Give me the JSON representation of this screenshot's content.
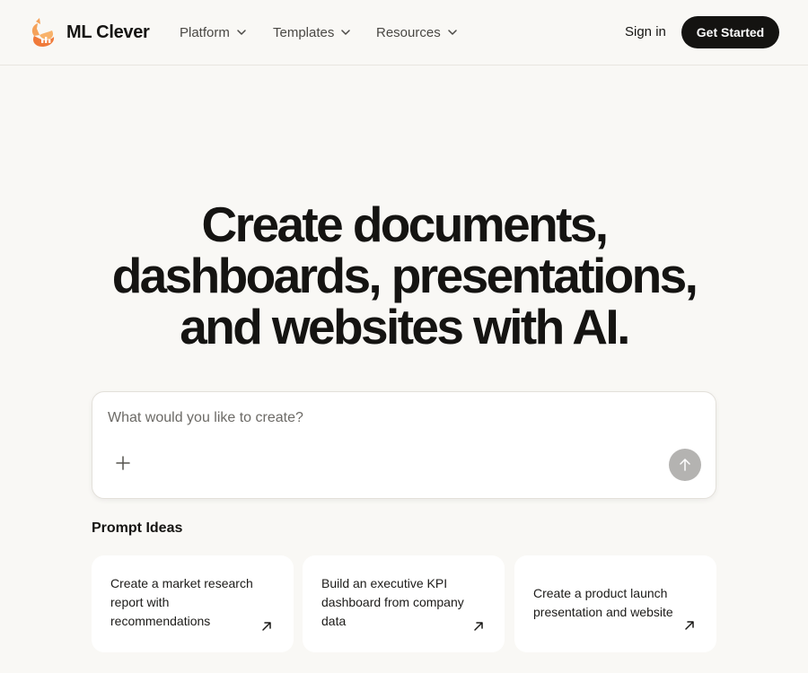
{
  "header": {
    "brand_name": "ML Clever",
    "logo_icon": "fox-logo-icon",
    "nav": [
      {
        "label": "Platform"
      },
      {
        "label": "Templates"
      },
      {
        "label": "Resources"
      }
    ],
    "signin_label": "Sign in",
    "cta_label": "Get Started"
  },
  "hero": {
    "title_lines": [
      "Create documents,",
      "dashboards, presentations,",
      "and websites with AI."
    ]
  },
  "prompt": {
    "value": "",
    "placeholder": "What would you like to create?",
    "attach_icon": "plus-icon",
    "send_icon": "arrow-up-icon"
  },
  "ideas": {
    "title": "Prompt Ideas",
    "cards": [
      {
        "text": "Create a market research report with recommendations"
      },
      {
        "text": "Build an executive KPI dashboard from company data"
      },
      {
        "text": "Create a product launch presentation and website"
      }
    ]
  },
  "colors": {
    "page_background": "#f9f8f5",
    "cta_background": "#141311",
    "send_button": "#b4b3b1",
    "logo_orange": "#f07a3a"
  }
}
